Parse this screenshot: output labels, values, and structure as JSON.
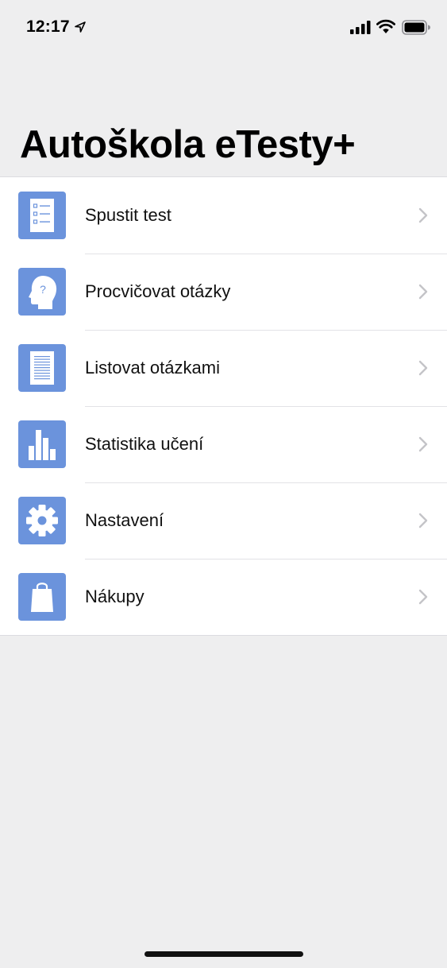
{
  "status_bar": {
    "time": "12:17"
  },
  "header": {
    "title": "Autoškola eTesty+"
  },
  "theme": {
    "icon_color": "#6b93dc",
    "chevron_color": "#c4c4c8"
  },
  "menu": {
    "items": [
      {
        "label": "Spustit test",
        "icon": "checklist-icon"
      },
      {
        "label": "Procvičovat otázky",
        "icon": "head-question-icon"
      },
      {
        "label": "Listovat otázkami",
        "icon": "document-icon"
      },
      {
        "label": "Statistika učení",
        "icon": "bar-chart-icon"
      },
      {
        "label": "Nastavení",
        "icon": "gear-icon"
      },
      {
        "label": "Nákupy",
        "icon": "shopping-bag-icon"
      }
    ]
  }
}
